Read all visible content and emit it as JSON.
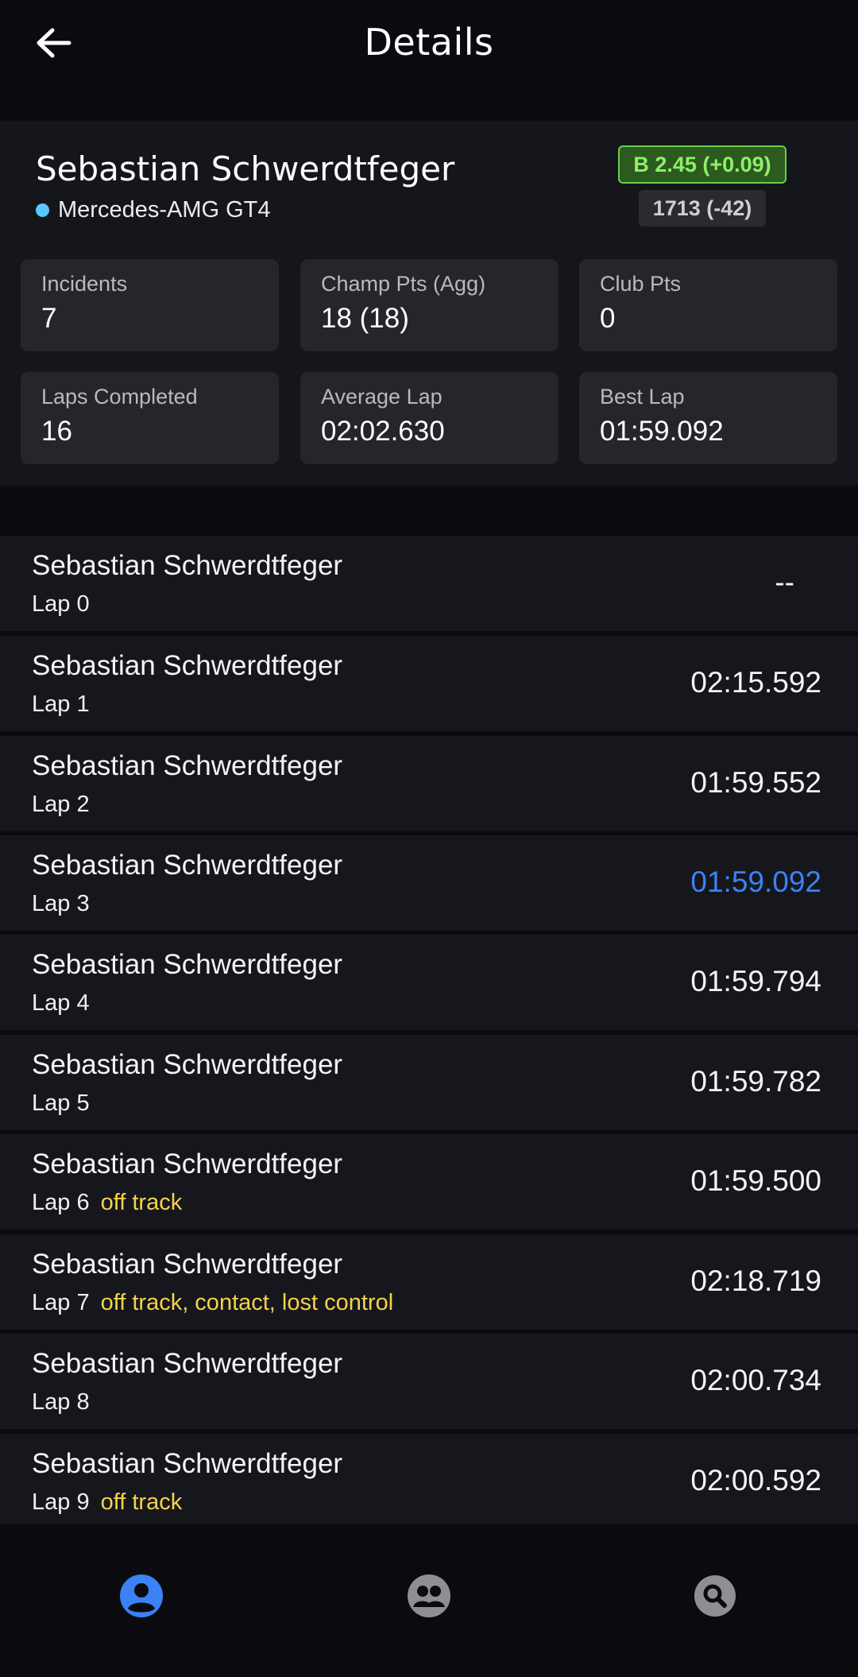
{
  "header": {
    "title": "Details",
    "back_icon": "arrow-left-icon"
  },
  "driver": {
    "name": "Sebastian Schwerdtfeger",
    "car": "Mercedes-AMG GT4",
    "car_dot_color": "#5ac8fa",
    "license_badge": "B 2.45 (+0.09)",
    "irating_badge": "1713 (-42)"
  },
  "stats": [
    {
      "label": "Incidents",
      "value": "7"
    },
    {
      "label": "Champ Pts (Agg)",
      "value": "18 (18)"
    },
    {
      "label": "Club Pts",
      "value": "0"
    },
    {
      "label": "Laps Completed",
      "value": "16"
    },
    {
      "label": "Average Lap",
      "value": "02:02.630"
    },
    {
      "label": "Best Lap",
      "value": "01:59.092"
    }
  ],
  "laps": [
    {
      "driver": "Sebastian Schwerdtfeger",
      "lap": "Lap 0",
      "flags": "",
      "time": "--"
    },
    {
      "driver": "Sebastian Schwerdtfeger",
      "lap": "Lap 1",
      "flags": "",
      "time": "02:15.592"
    },
    {
      "driver": "Sebastian Schwerdtfeger",
      "lap": "Lap 2",
      "flags": "",
      "time": "01:59.552"
    },
    {
      "driver": "Sebastian Schwerdtfeger",
      "lap": "Lap 3",
      "flags": "",
      "time": "01:59.092"
    },
    {
      "driver": "Sebastian Schwerdtfeger",
      "lap": "Lap 4",
      "flags": "",
      "time": "01:59.794"
    },
    {
      "driver": "Sebastian Schwerdtfeger",
      "lap": "Lap 5",
      "flags": "",
      "time": "01:59.782"
    },
    {
      "driver": "Sebastian Schwerdtfeger",
      "lap": "Lap 6",
      "flags": "off track",
      "time": "01:59.500"
    },
    {
      "driver": "Sebastian Schwerdtfeger",
      "lap": "Lap 7",
      "flags": "off track, contact, lost control",
      "time": "02:18.719"
    },
    {
      "driver": "Sebastian Schwerdtfeger",
      "lap": "Lap 8",
      "flags": "",
      "time": "02:00.734"
    },
    {
      "driver": "Sebastian Schwerdtfeger",
      "lap": "Lap 9",
      "flags": "off track",
      "time": "02:00.592"
    }
  ],
  "colors": {
    "best_lap": "#3b82f6",
    "flag_text": "#f5d24a",
    "nav_active": "#3b82f6",
    "nav_inactive": "#8e8e93"
  },
  "bottom_nav": [
    {
      "icon": "profile-icon",
      "active": true
    },
    {
      "icon": "group-icon",
      "active": false
    },
    {
      "icon": "search-icon",
      "active": false
    }
  ]
}
